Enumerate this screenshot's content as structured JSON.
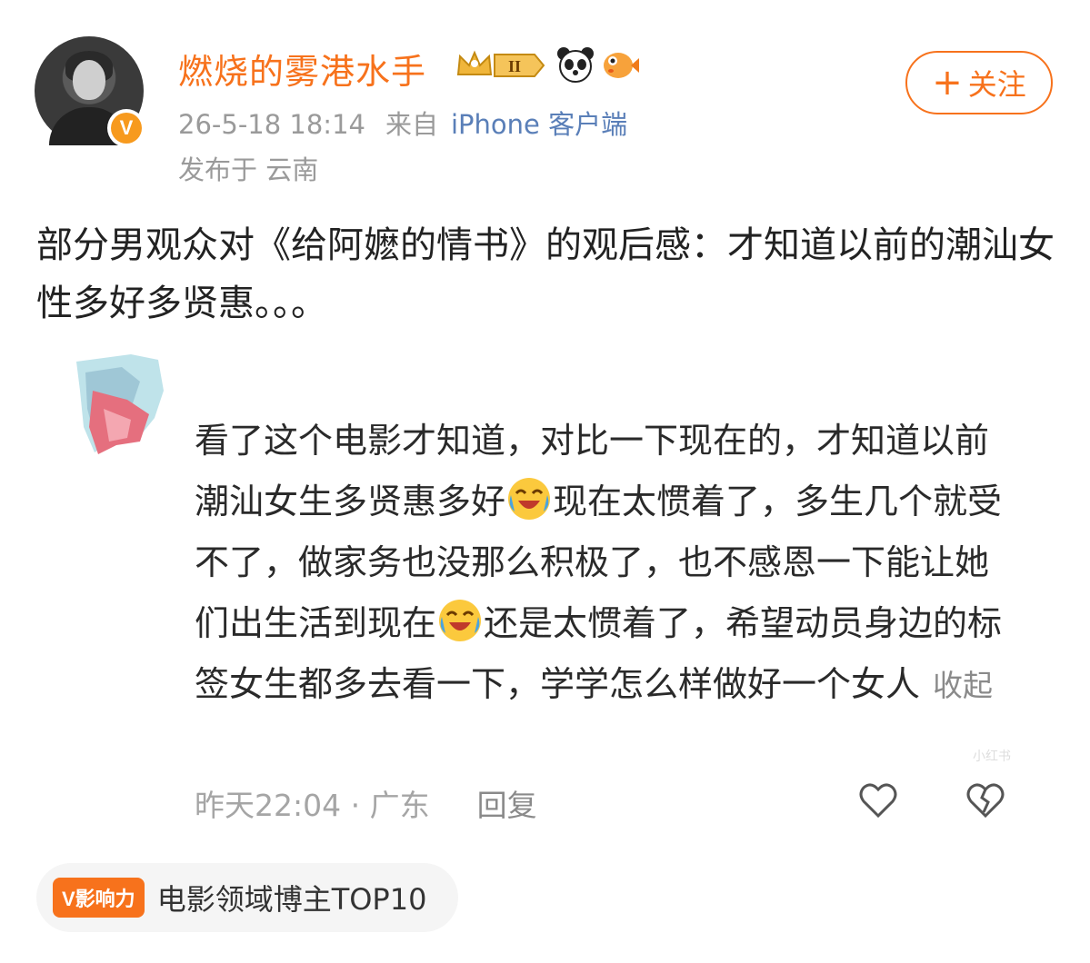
{
  "header": {
    "username": "燃烧的雾港水手",
    "verified_badge": "V",
    "level_badge": "II",
    "timestamp": "26-5-18 18:14",
    "source_prefix": "来自",
    "source": "iPhone 客户端",
    "location": "发布于 云南",
    "follow_plus": "+",
    "follow_label": "关注"
  },
  "post": {
    "text": "部分男观众对《给阿嬷的情书》的观后感：才知道以前的潮汕女性多好多贤惠。。。"
  },
  "embedded_comment": {
    "segments": [
      "看了这个电影才知道，对比一下现在的，才知道以前潮汕女生多贤惠多好",
      "现在太惯着了，多生几个就受不了，做家务也没那么积极了，也不感恩一下能让她们出生活到现在",
      "还是太惯着了，希望动员身边的标签女生都多去看一下，学学怎么样做好一个女人"
    ],
    "emoji_name": "laugh-cry-emoji",
    "collapse_label": "收起",
    "time_location": "昨天22:04 · 广东",
    "reply_label": "回复",
    "watermark": "小红书"
  },
  "influence": {
    "tag": "V影响力",
    "label": "电影领域博主TOP10"
  },
  "colors": {
    "accent": "#f7721c",
    "source_link": "#5a7fb8",
    "muted": "#9a9a9a"
  }
}
